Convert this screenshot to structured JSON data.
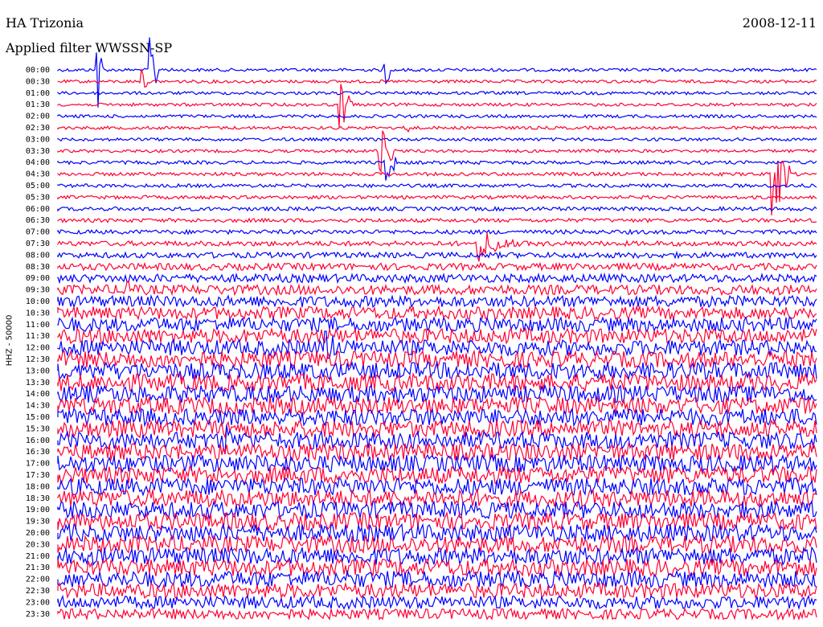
{
  "header": {
    "station": "HA Trizonia",
    "filter": "Applied filter WWSSN-SP",
    "date": "2008-12-11",
    "channel": "HHZ - 50000"
  },
  "colors": {
    "trace_a": "#0000ff",
    "trace_b": "#ff0033"
  },
  "chart_data": {
    "type": "line",
    "title": "",
    "xlabel": "",
    "ylabel": "HHZ - 50000",
    "rows": [
      "00:00",
      "00:30",
      "01:00",
      "01:30",
      "02:00",
      "02:30",
      "03:00",
      "03:30",
      "04:00",
      "04:30",
      "05:00",
      "05:30",
      "06:00",
      "06:30",
      "07:00",
      "07:30",
      "08:00",
      "08:30",
      "09:00",
      "09:30",
      "10:00",
      "10:30",
      "11:00",
      "11:30",
      "12:00",
      "12:30",
      "13:00",
      "13:30",
      "14:00",
      "14:30",
      "15:00",
      "15:30",
      "16:00",
      "16:30",
      "17:00",
      "17:30",
      "18:00",
      "18:30",
      "19:00",
      "19:30",
      "20:00",
      "20:30",
      "21:00",
      "21:30",
      "22:00",
      "22:30",
      "23:00",
      "23:30"
    ],
    "row_labels": [
      "00:00",
      "00:30",
      "01:00",
      "01:30",
      "02:00",
      "02:30",
      "03:00",
      "03:30",
      "04:00",
      "04:30",
      "05:00",
      "05:30",
      "06:00",
      "06:30",
      "07:00",
      "07:30",
      "08:00",
      "08:30",
      "09:00",
      "09:30",
      "10:00",
      "10:30",
      "11:00",
      "11:30",
      "12:00",
      "12:30",
      "13:00",
      "13:30",
      "14:00",
      "14:30",
      "15:00",
      "15:30",
      "16:00",
      "16:30",
      "17:00",
      "17:30",
      "18:00",
      "18:30",
      "19:00",
      "19:30",
      "20:00",
      "20:30",
      "21:00",
      "21:30",
      "22:00",
      "22:30",
      "23:00",
      "23:30"
    ],
    "noise_by_row": [
      0.04,
      0.04,
      0.04,
      0.04,
      0.04,
      0.04,
      0.04,
      0.04,
      0.05,
      0.05,
      0.05,
      0.05,
      0.06,
      0.06,
      0.07,
      0.09,
      0.11,
      0.14,
      0.18,
      0.22,
      0.26,
      0.3,
      0.34,
      0.36,
      0.38,
      0.4,
      0.42,
      0.42,
      0.42,
      0.42,
      0.42,
      0.42,
      0.42,
      0.42,
      0.42,
      0.42,
      0.42,
      0.42,
      0.42,
      0.42,
      0.42,
      0.42,
      0.42,
      0.42,
      0.4,
      0.36,
      0.3,
      0.24
    ],
    "events": [
      {
        "row": 0,
        "pos": 0.05,
        "amp": 6,
        "len": 0.01
      },
      {
        "row": 0,
        "pos": 0.12,
        "amp": 3,
        "len": 0.02
      },
      {
        "row": 0,
        "pos": 0.43,
        "amp": 2,
        "len": 0.01
      },
      {
        "row": 1,
        "pos": 0.11,
        "amp": 2,
        "len": 0.01
      },
      {
        "row": 3,
        "pos": 0.37,
        "amp": 2.5,
        "len": 0.02
      },
      {
        "row": 5,
        "pos": 0.46,
        "amp": 1.5,
        "len": 0.01
      },
      {
        "row": 7,
        "pos": 0.42,
        "amp": 3,
        "len": 0.03
      },
      {
        "row": 8,
        "pos": 0.43,
        "amp": 2,
        "len": 0.02
      },
      {
        "row": 9,
        "pos": 0.94,
        "amp": 4,
        "len": 0.03
      },
      {
        "row": 15,
        "pos": 0.55,
        "amp": 1.5,
        "len": 0.06
      },
      {
        "row": 19,
        "pos": 0.09,
        "amp": 2,
        "len": 0.01
      },
      {
        "row": 24,
        "pos": 0.35,
        "amp": 2,
        "len": 0.02
      },
      {
        "row": 32,
        "pos": 0.22,
        "amp": 2.5,
        "len": 0.01
      }
    ]
  }
}
